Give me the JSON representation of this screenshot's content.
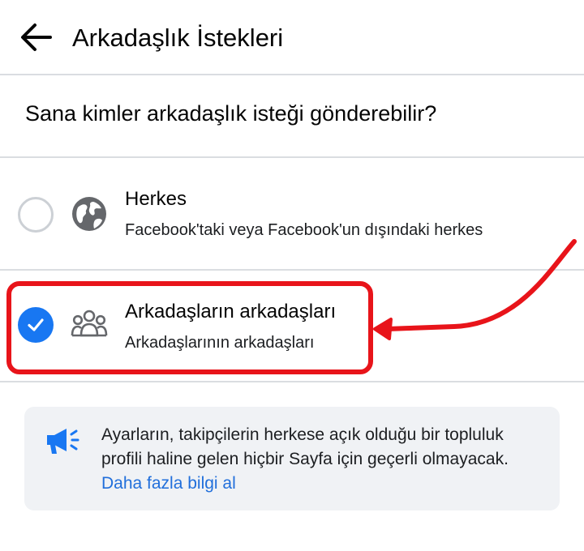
{
  "header": {
    "back_icon": "arrow-left-icon",
    "title": "Arkadaşlık İstekleri"
  },
  "question": "Sana kimler arkadaşlık isteği gönderebilir?",
  "options": [
    {
      "title": "Herkes",
      "subtitle": "Facebook'taki veya Facebook'un dışındaki herkes",
      "icon": "globe-icon",
      "selected": false
    },
    {
      "title": "Arkadaşların arkadaşları",
      "subtitle": "Arkadaşlarının arkadaşları",
      "icon": "people-group-icon",
      "selected": true
    }
  ],
  "info": {
    "icon": "megaphone-icon",
    "text": "Ayarların, takipçilerin herkese açık olduğu bir topluluk profili haline gelen hiçbir Sayfa için geçerli olmayacak.",
    "link": "Daha fazla bilgi al"
  },
  "colors": {
    "accent": "#1877f2",
    "link": "#216fdb",
    "annotation": "#e8141a",
    "divider": "#dadde1",
    "info_bg": "#f0f2f5"
  }
}
